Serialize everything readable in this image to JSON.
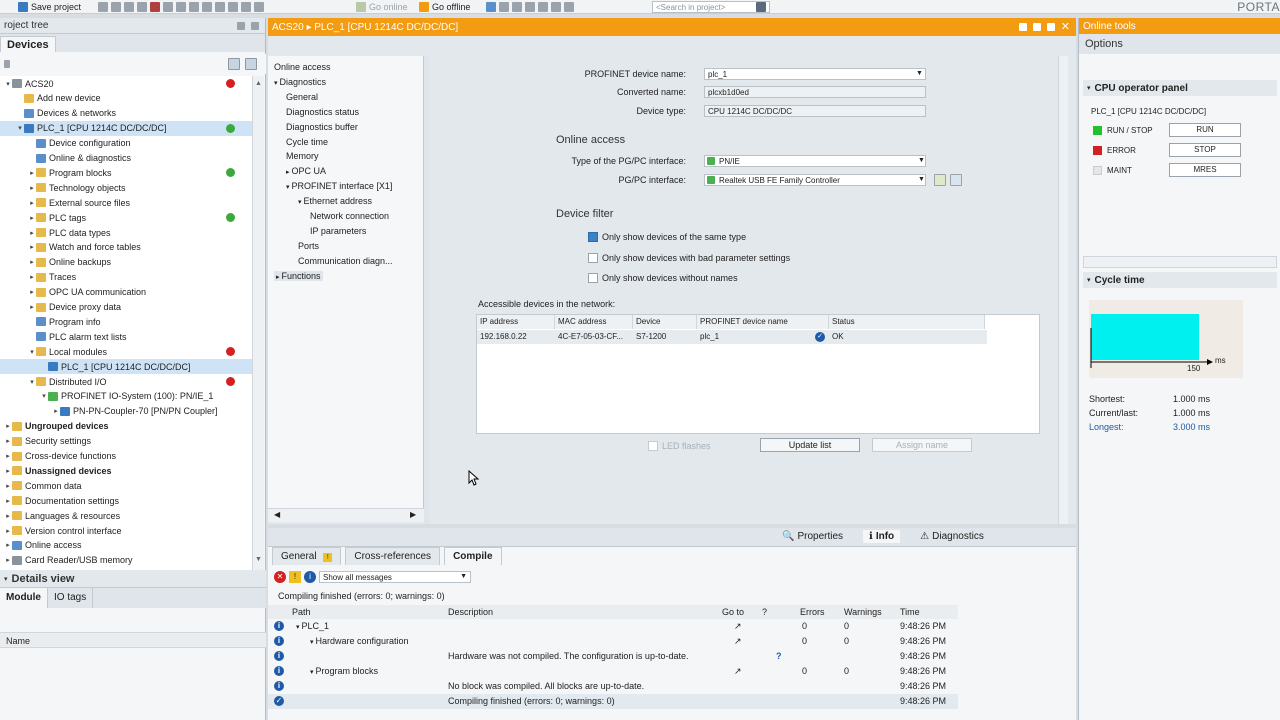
{
  "toolbar": {
    "save_project": "Save project",
    "go_online": "Go online",
    "go_offline": "Go offline",
    "search_placeholder": "<Search in project>",
    "portal": "PORTA"
  },
  "left": {
    "header": "roject tree",
    "tab": "Devices",
    "tree": [
      {
        "label": "ACS20",
        "indent": 0,
        "tri": "▾",
        "icon": "#8a939b"
      },
      {
        "label": "Add new device",
        "indent": 1,
        "tri": "",
        "icon": "#e7b84a"
      },
      {
        "label": "Devices & networks",
        "indent": 1,
        "tri": "",
        "icon": "#5a8fc9"
      },
      {
        "label": "PLC_1 [CPU 1214C DC/DC/DC]",
        "indent": 1,
        "tri": "▾",
        "icon": "#3a7ac0",
        "sel": true
      },
      {
        "label": "Device configuration",
        "indent": 2,
        "tri": "",
        "icon": "#5a8fc9"
      },
      {
        "label": "Online & diagnostics",
        "indent": 2,
        "tri": "",
        "icon": "#5a8fc9"
      },
      {
        "label": "Program blocks",
        "indent": 2,
        "tri": "▸",
        "icon": "#e7b84a"
      },
      {
        "label": "Technology objects",
        "indent": 2,
        "tri": "▸",
        "icon": "#e7b84a"
      },
      {
        "label": "External source files",
        "indent": 2,
        "tri": "▸",
        "icon": "#e7b84a"
      },
      {
        "label": "PLC tags",
        "indent": 2,
        "tri": "▸",
        "icon": "#e7b84a"
      },
      {
        "label": "PLC data types",
        "indent": 2,
        "tri": "▸",
        "icon": "#e7b84a"
      },
      {
        "label": "Watch and force tables",
        "indent": 2,
        "tri": "▸",
        "icon": "#e7b84a"
      },
      {
        "label": "Online backups",
        "indent": 2,
        "tri": "▸",
        "icon": "#e7b84a"
      },
      {
        "label": "Traces",
        "indent": 2,
        "tri": "▸",
        "icon": "#e7b84a"
      },
      {
        "label": "OPC UA communication",
        "indent": 2,
        "tri": "▸",
        "icon": "#e7b84a"
      },
      {
        "label": "Device proxy data",
        "indent": 2,
        "tri": "▸",
        "icon": "#e7b84a"
      },
      {
        "label": "Program info",
        "indent": 2,
        "tri": "",
        "icon": "#5a8fc9"
      },
      {
        "label": "PLC alarm text lists",
        "indent": 2,
        "tri": "",
        "icon": "#5a8fc9"
      },
      {
        "label": "Local modules",
        "indent": 2,
        "tri": "▾",
        "icon": "#e7b84a"
      },
      {
        "label": "PLC_1 [CPU 1214C DC/DC/DC]",
        "indent": 3,
        "tri": "",
        "icon": "#3a7ac0",
        "sel": true
      },
      {
        "label": "Distributed I/O",
        "indent": 2,
        "tri": "▾",
        "icon": "#e7b84a"
      },
      {
        "label": "PROFINET IO-System (100): PN/IE_1",
        "indent": 3,
        "tri": "▾",
        "icon": "#4caf50"
      },
      {
        "label": "PN-PN-Coupler-70 [PN/PN Coupler]",
        "indent": 4,
        "tri": "▸",
        "icon": "#3a7ac0"
      },
      {
        "label": "Ungrouped devices",
        "indent": 0,
        "tri": "▸",
        "icon": "#e7b84a",
        "bold": true
      },
      {
        "label": "Security settings",
        "indent": 0,
        "tri": "▸",
        "icon": "#e7b84a"
      },
      {
        "label": "Cross-device functions",
        "indent": 0,
        "tri": "▸",
        "icon": "#e7b84a"
      },
      {
        "label": "Unassigned devices",
        "indent": 0,
        "tri": "▸",
        "icon": "#e7b84a",
        "bold": true
      },
      {
        "label": "Common data",
        "indent": 0,
        "tri": "▸",
        "icon": "#e7b84a"
      },
      {
        "label": "Documentation settings",
        "indent": 0,
        "tri": "▸",
        "icon": "#e7b84a"
      },
      {
        "label": "Languages & resources",
        "indent": 0,
        "tri": "▸",
        "icon": "#e7b84a"
      },
      {
        "label": "Version control interface",
        "indent": 0,
        "tri": "▸",
        "icon": "#e7b84a"
      },
      {
        "label": "Online access",
        "indent": 0,
        "tri": "▸",
        "icon": "#5a8fc9"
      },
      {
        "label": "Card Reader/USB memory",
        "indent": 0,
        "tri": "▸",
        "icon": "#8a939b"
      }
    ],
    "details": {
      "header": "Details view",
      "tabs": [
        "Module",
        "IO tags"
      ],
      "col_name": "Name"
    }
  },
  "editor": {
    "title": "ACS20 ▸ PLC_1 [CPU 1214C DC/DC/DC]",
    "nav": [
      {
        "label": "Online access",
        "indent": 0,
        "tri": ""
      },
      {
        "label": "Diagnostics",
        "indent": 0,
        "tri": "▾"
      },
      {
        "label": "General",
        "indent": 1,
        "tri": ""
      },
      {
        "label": "Diagnostics status",
        "indent": 1,
        "tri": ""
      },
      {
        "label": "Diagnostics buffer",
        "indent": 1,
        "tri": ""
      },
      {
        "label": "Cycle time",
        "indent": 1,
        "tri": ""
      },
      {
        "label": "Memory",
        "indent": 1,
        "tri": ""
      },
      {
        "label": "OPC UA",
        "indent": 1,
        "tri": "▸"
      },
      {
        "label": "PROFINET interface [X1]",
        "indent": 1,
        "tri": "▾"
      },
      {
        "label": "Ethernet address",
        "indent": 2,
        "tri": "▾"
      },
      {
        "label": "Network connection",
        "indent": 3,
        "tri": ""
      },
      {
        "label": "IP parameters",
        "indent": 3,
        "tri": ""
      },
      {
        "label": "Ports",
        "indent": 2,
        "tri": ""
      },
      {
        "label": "Communication diagn...",
        "indent": 2,
        "tri": ""
      },
      {
        "label": "Functions",
        "indent": 0,
        "tri": "▸",
        "sel": true
      }
    ],
    "fields": {
      "profinet_name_label": "PROFINET device name:",
      "profinet_name_value": "plc_1",
      "converted_label": "Converted name:",
      "converted_value": "plcxb1d0ed",
      "device_type_label": "Device type:",
      "device_type_value": "CPU 1214C DC/DC/DC"
    },
    "online_access": {
      "title": "Online access",
      "pgpc_type_label": "Type of the PG/PC interface:",
      "pgpc_type_value": "PN/IE",
      "pgpc_label": "PG/PC interface:",
      "pgpc_value": "Realtek USB FE Family Controller"
    },
    "device_filter": {
      "title": "Device filter",
      "options": [
        {
          "label": "Only show devices of the same type",
          "checked": true
        },
        {
          "label": "Only show devices with bad parameter settings",
          "checked": false
        },
        {
          "label": "Only show devices without names",
          "checked": false
        }
      ]
    },
    "accessible": {
      "label": "Accessible devices in the network:",
      "columns": [
        "IP address",
        "MAC address",
        "Device",
        "PROFINET device name",
        "Status"
      ],
      "rows": [
        {
          "ip": "192.168.0.22",
          "mac": "4C-E7-05-03-CF...",
          "device": "S7-1200",
          "name": "plc_1",
          "status": "OK"
        }
      ]
    },
    "led_flashes": "LED flashes",
    "update_list": "Update list",
    "assign_name": "Assign name"
  },
  "inspector": {
    "prop_tabs": [
      "Properties",
      "Info",
      "Diagnostics"
    ],
    "tabs": [
      "General",
      "Cross-references",
      "Compile"
    ],
    "filter": "Show all messages",
    "summary": "Compiling finished (errors: 0; warnings: 0)",
    "columns": {
      "path": "Path",
      "desc": "Description",
      "goto": "Go to",
      "q": "?",
      "errors": "Errors",
      "warnings": "Warnings",
      "time": "Time"
    },
    "rows": [
      {
        "path": "PLC_1",
        "indent": 0,
        "tri": "▾",
        "desc": "",
        "goto": "↗",
        "q": "",
        "errors": "0",
        "warnings": "0",
        "time": "9:48:26 PM"
      },
      {
        "path": "Hardware configuration",
        "indent": 1,
        "tri": "▾",
        "desc": "",
        "goto": "↗",
        "q": "",
        "errors": "0",
        "warnings": "0",
        "time": "9:48:26 PM"
      },
      {
        "path": "",
        "indent": 2,
        "tri": "",
        "desc": "Hardware was not compiled. The configuration is up-to-date.",
        "goto": "",
        "q": "?",
        "errors": "",
        "warnings": "",
        "time": "9:48:26 PM"
      },
      {
        "path": "Program blocks",
        "indent": 1,
        "tri": "▾",
        "desc": "",
        "goto": "↗",
        "q": "",
        "errors": "0",
        "warnings": "0",
        "time": "9:48:26 PM"
      },
      {
        "path": "",
        "indent": 2,
        "tri": "",
        "desc": "No block was compiled. All blocks are up-to-date.",
        "goto": "",
        "q": "",
        "errors": "",
        "warnings": "",
        "time": "9:48:26 PM"
      },
      {
        "path": "",
        "indent": 2,
        "tri": "",
        "desc": "Compiling finished (errors: 0; warnings: 0)",
        "goto": "",
        "q": "",
        "errors": "",
        "warnings": "",
        "time": "9:48:26 PM",
        "hl": true
      }
    ]
  },
  "right": {
    "title": "Online tools",
    "options": "Options",
    "cpu_panel": {
      "title": "CPU operator panel",
      "device": "PLC_1 [CPU 1214C DC/DC/DC]",
      "leds": [
        {
          "label": "RUN / STOP",
          "color": "#22c02a",
          "button": "RUN"
        },
        {
          "label": "ERROR",
          "color": "#d42020",
          "button": "STOP"
        },
        {
          "label": "MAINT",
          "color": "#e6e6e6",
          "button": "MRES"
        }
      ]
    },
    "cycle": {
      "title": "Cycle time",
      "axis_max": "150",
      "axis_unit": "ms",
      "rows": [
        {
          "label": "Shortest:",
          "value": "1.000 ms"
        },
        {
          "label": "Current/last:",
          "value": "1.000 ms"
        },
        {
          "label": "Longest:",
          "value": "3.000 ms"
        }
      ]
    }
  }
}
